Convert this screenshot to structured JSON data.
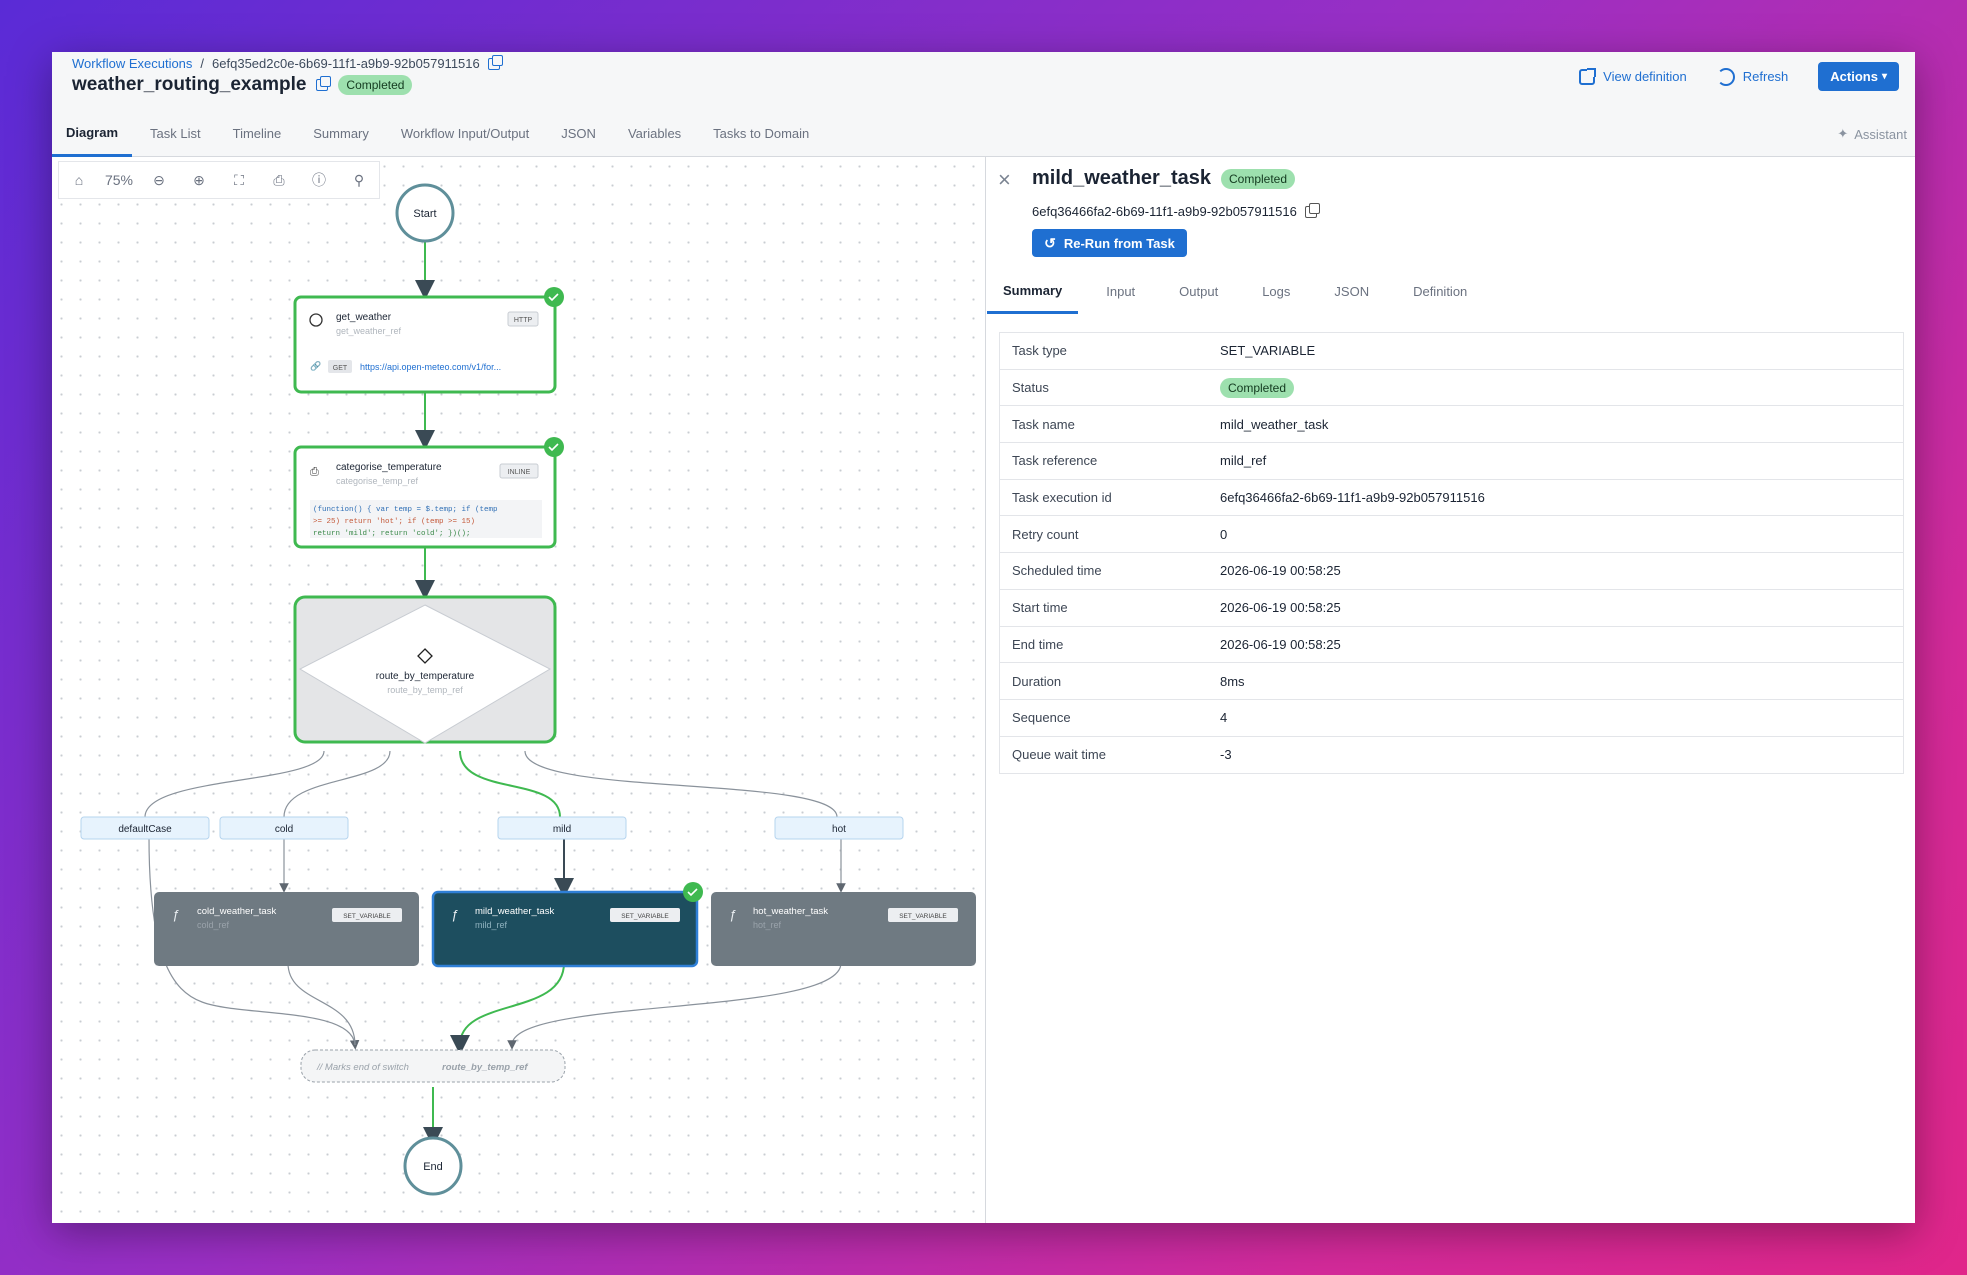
{
  "breadcrumb": {
    "root": "Workflow Executions",
    "sep": "/",
    "execution_id": "6efq35ed2c0e-6b69-11f1-a9b9-92b057911516"
  },
  "workflow": {
    "name": "weather_routing_example",
    "status": "Completed"
  },
  "header_actions": {
    "view_definition": "View definition",
    "refresh": "Refresh",
    "actions": "Actions"
  },
  "tabs": [
    "Diagram",
    "Task List",
    "Timeline",
    "Summary",
    "Workflow Input/Output",
    "JSON",
    "Variables",
    "Tasks to Domain"
  ],
  "assistant": "Assistant",
  "toolbar": {
    "zoom": "75%"
  },
  "diagram": {
    "start": "Start",
    "end": "End",
    "get_weather": {
      "name": "get_weather",
      "ref": "get_weather_ref",
      "type": "HTTP",
      "method": "GET",
      "url": "https://api.open-meteo.com/v1/for..."
    },
    "categorise": {
      "name": "categorise_temperature",
      "ref": "categorise_temp_ref",
      "type": "INLINE",
      "code1": "(function() { var temp = $.temp; if (temp",
      "code2": ">= 25) return 'hot'; if (temp >= 15)",
      "code3": "return 'mild'; return 'cold'; })();"
    },
    "switch": {
      "name": "route_by_temperature",
      "ref": "route_by_temp_ref"
    },
    "cases": [
      "defaultCase",
      "cold",
      "mild",
      "hot"
    ],
    "cold_task": {
      "name": "cold_weather_task",
      "ref": "cold_ref",
      "type": "SET_VARIABLE"
    },
    "mild_task": {
      "name": "mild_weather_task",
      "ref": "mild_ref",
      "type": "SET_VARIABLE"
    },
    "hot_task": {
      "name": "hot_weather_task",
      "ref": "hot_ref",
      "type": "SET_VARIABLE"
    },
    "join": {
      "comment": "// Marks end of switch",
      "ref": "route_by_temp_ref"
    }
  },
  "panel": {
    "title": "mild_weather_task",
    "status": "Completed",
    "task_id": "6efq36466fa2-6b69-11f1-a9b9-92b057911516",
    "rerun": "Re-Run from Task",
    "tabs": [
      "Summary",
      "Input",
      "Output",
      "Logs",
      "JSON",
      "Definition"
    ],
    "rows": [
      {
        "k": "Task type",
        "v": "SET_VARIABLE"
      },
      {
        "k": "Status",
        "v": "Completed"
      },
      {
        "k": "Task name",
        "v": "mild_weather_task"
      },
      {
        "k": "Task reference",
        "v": "mild_ref"
      },
      {
        "k": "Task execution id",
        "v": "6efq36466fa2-6b69-11f1-a9b9-92b057911516"
      },
      {
        "k": "Retry count",
        "v": "0"
      },
      {
        "k": "Scheduled time",
        "v": "2026-06-19 00:58:25"
      },
      {
        "k": "Start time",
        "v": "2026-06-19 00:58:25"
      },
      {
        "k": "End time",
        "v": "2026-06-19 00:58:25"
      },
      {
        "k": "Duration",
        "v": "8ms"
      },
      {
        "k": "Sequence",
        "v": "4"
      },
      {
        "k": "Queue wait time",
        "v": "-3"
      }
    ]
  },
  "colors": {
    "accent": "#1f6fd1",
    "success": "#3fb950",
    "badge": "#9de0ae",
    "node_grey": "#6f7a82",
    "node_selected": "#1d4e5f"
  }
}
